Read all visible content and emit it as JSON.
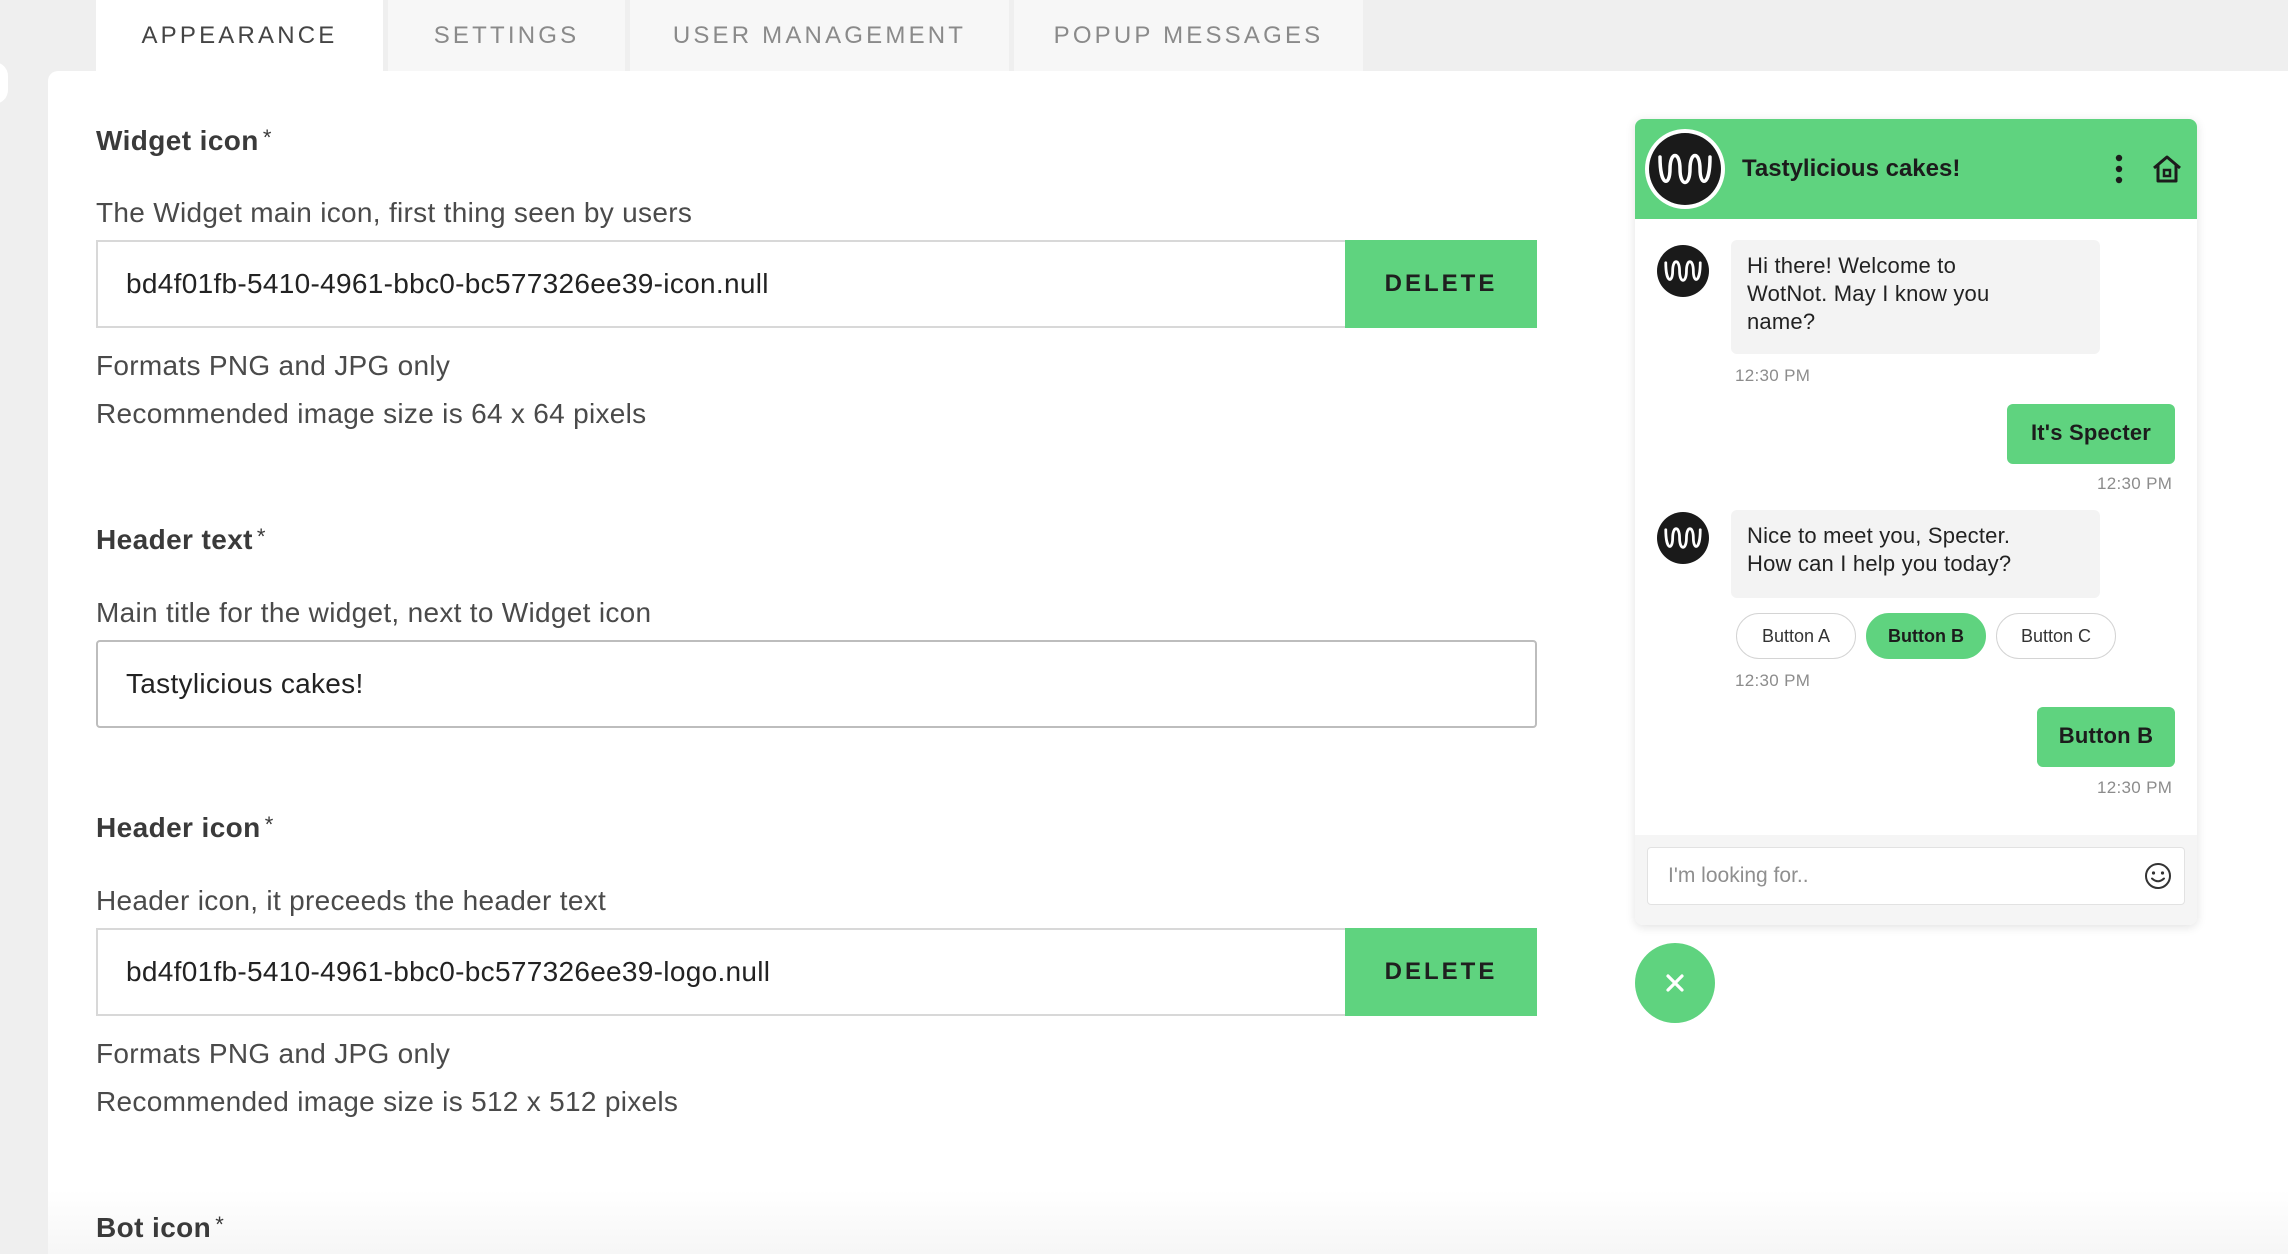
{
  "tabs": [
    {
      "label": "APPEARANCE"
    },
    {
      "label": "SETTINGS"
    },
    {
      "label": "USER MANAGEMENT"
    },
    {
      "label": "POPUP MESSAGES"
    }
  ],
  "widget_icon": {
    "label": "Widget icon",
    "required_mark": "*",
    "description": "The Widget main icon, first thing seen by users",
    "value": "bd4f01fb-5410-4961-bbc0-bc577326ee39-icon.null",
    "delete_label": "DELETE",
    "formats_note": "Formats PNG and JPG only",
    "size_note": "Recommended image size is 64 x 64 pixels"
  },
  "header_text": {
    "label": "Header text",
    "required_mark": "*",
    "description": "Main title for the widget, next to Widget icon",
    "value": "Tastylicious cakes!"
  },
  "header_icon": {
    "label": "Header icon",
    "required_mark": "*",
    "description": "Header icon, it preceeds the header text",
    "value": "bd4f01fb-5410-4961-bbc0-bc577326ee39-logo.null",
    "delete_label": "DELETE",
    "formats_note": "Formats PNG and JPG only",
    "size_note": "Recommended image size is 512 x 512 pixels"
  },
  "bot_icon": {
    "label": "Bot icon",
    "required_mark": "*"
  },
  "chat": {
    "title": "Tastylicious cakes!",
    "messages": {
      "m1": {
        "line1": "Hi there! Welcome to",
        "line2": "WotNot. May I know you",
        "line3": "name?",
        "time": "12:30 PM"
      },
      "m2": {
        "text": "It's Specter",
        "time": "12:30 PM"
      },
      "m3": {
        "line1": "Nice to meet you, Specter.",
        "line2": "How can I help you today?",
        "time": "12:30 PM"
      },
      "m4": {
        "text": "Button B",
        "time": "12:30 PM"
      }
    },
    "quick_replies": [
      "Button A",
      "Button B",
      "Button C"
    ],
    "selected_reply": "Button B",
    "input_placeholder": "I'm looking for.."
  },
  "colors": {
    "accent": "#5fd37f",
    "background": "#efefef",
    "panel": "#ffffff"
  },
  "icons": {
    "header_menu": "kebab-menu-icon",
    "header_home": "home-icon",
    "emoji": "smiley-icon",
    "close": "close-icon"
  }
}
